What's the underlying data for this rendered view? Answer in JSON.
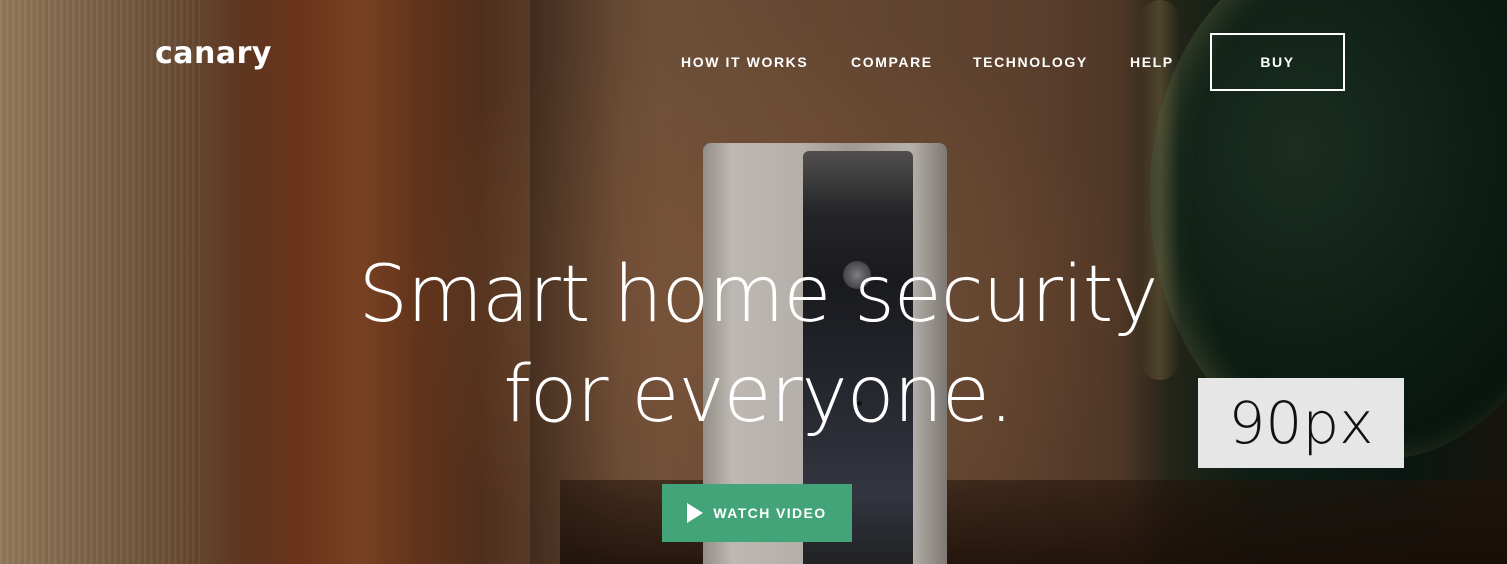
{
  "brand": {
    "logo_text": "canary"
  },
  "nav": {
    "items": [
      {
        "label": "HOW IT WORKS"
      },
      {
        "label": "COMPARE"
      },
      {
        "label": "TECHNOLOGY"
      },
      {
        "label": "HELP"
      }
    ],
    "buy_label": "BUY"
  },
  "hero": {
    "headline_line1": "Smart home security",
    "headline_line2": "for everyone.",
    "cta_label": "WATCH VIDEO",
    "cta_icon": "play-icon",
    "cta_color": "#43a47a"
  },
  "overlay": {
    "size_label": "90px"
  }
}
